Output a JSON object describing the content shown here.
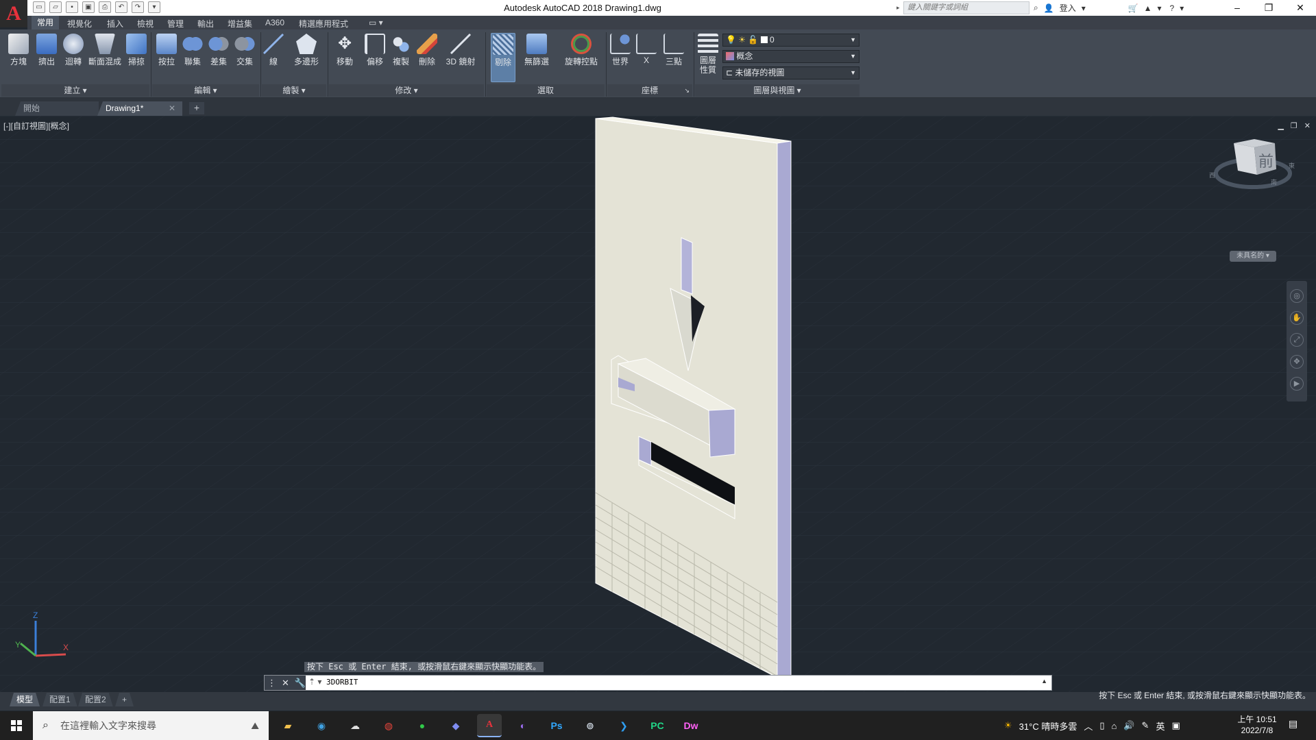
{
  "app": {
    "logo_letter": "A",
    "title": "Autodesk AutoCAD 2018    Drawing1.dwg",
    "search_placeholder": "鍵入關鍵字或詞組",
    "signin_label": "登入"
  },
  "menu_tabs": [
    "常用",
    "視覺化",
    "插入",
    "檢視",
    "管理",
    "輸出",
    "增益集",
    "A360",
    "精選應用程式"
  ],
  "ribbon": {
    "create": {
      "title": "建立",
      "buttons": [
        "方塊",
        "擠出",
        "迴轉",
        "斷面混成",
        "掃掠"
      ]
    },
    "edit": {
      "title": "編輯",
      "buttons": [
        "按拉",
        "聯集",
        "差集",
        "交集"
      ]
    },
    "draw": {
      "title": "繪製",
      "buttons": [
        "線",
        "多邊形"
      ]
    },
    "modify": {
      "title": "修改",
      "buttons": [
        "移動",
        "偏移",
        "複製",
        "刪除",
        "3D 鏡射"
      ]
    },
    "selection": {
      "title": "選取",
      "buttons": [
        "剔除",
        "無篩選",
        "旋轉控點"
      ]
    },
    "coordinates": {
      "title": "座標",
      "buttons": [
        "世界",
        "X",
        "三點"
      ]
    },
    "layers": {
      "title": "圖層與視圖",
      "button": "圖層性質",
      "layer_name": "0",
      "visual_style": "概念",
      "view_name": "未儲存的視圖"
    }
  },
  "file_tabs": {
    "start": "開始",
    "drawing": "Drawing1*",
    "add": "+"
  },
  "viewport": {
    "label": "[-][自訂視圖][概念]",
    "viewcube_face": "前",
    "viewcube_dirs": {
      "west": "西",
      "south": "南",
      "east": "東"
    },
    "unnamed_label": "未具名的",
    "ucs": {
      "x": "X",
      "y": "Y",
      "z": "Z"
    }
  },
  "command": {
    "history": "按下 Esc 或 Enter 結束, 或按滑鼠右鍵來顯示快顯功能表。",
    "input": "3DORBIT"
  },
  "layout_tabs": [
    "模型",
    "配置1",
    "配置2",
    "+"
  ],
  "status_message": "按下 Esc 或 Enter 結束, 或按滑鼠右鍵來顯示快顯功能表。",
  "taskbar": {
    "search_placeholder": "在這裡輸入文字來搜尋",
    "apps": [
      "explorer",
      "edge",
      "stack",
      "chrome",
      "line",
      "discord",
      "autocad",
      "github",
      "Ps",
      "steam",
      "vscode",
      "PC",
      "Dw"
    ],
    "weather": "31°C  晴時多雲",
    "ime": "英",
    "time": "上午 10:51",
    "date": "2022/7/8"
  },
  "colors": {
    "viewport_bg": "#212830",
    "ribbon_bg": "#434a54",
    "panel_face": "#e4e3d6",
    "panel_edge": "#a9a9d2",
    "accent_active": "#5d7fa6"
  }
}
